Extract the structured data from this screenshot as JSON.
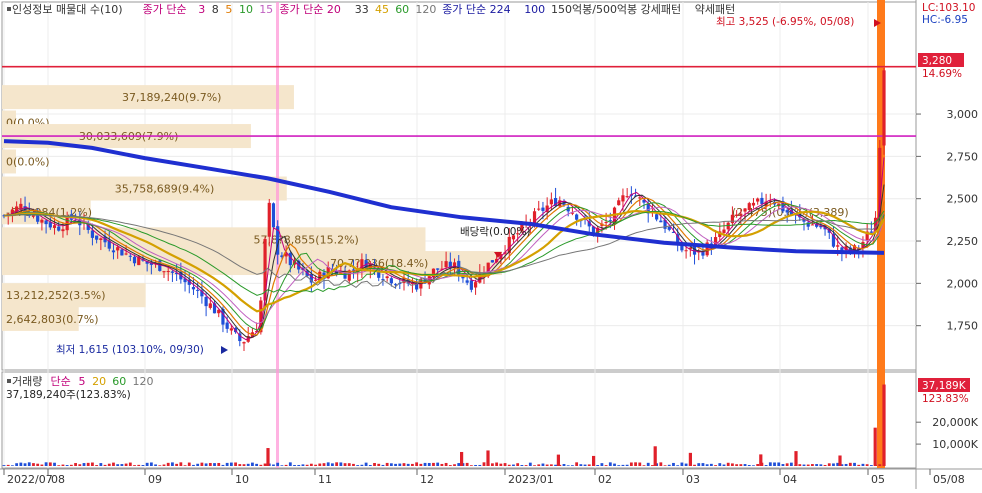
{
  "legend_main": [
    {
      "text": "인성정보 매물대 수(10)",
      "color": "#333333"
    },
    {
      "text": "종가 단순",
      "color": "#c0007a"
    },
    {
      "text": "3",
      "color": "#c0007a"
    },
    {
      "text": "8",
      "color": "#333333"
    },
    {
      "text": "5",
      "color": "#e07a00"
    },
    {
      "text": "10",
      "color": "#2a9a2a"
    },
    {
      "text": "15",
      "color": "#c060c0"
    },
    {
      "text": "종가 단순 20",
      "color": "#c0007a"
    },
    {
      "text": "33",
      "color": "#333333"
    },
    {
      "text": "45",
      "color": "#d4a000"
    },
    {
      "text": "60",
      "color": "#2a9a2a"
    },
    {
      "text": "120",
      "color": "#777777"
    },
    {
      "text": "종가 단순 224",
      "color": "#1a1aa0"
    },
    {
      "text": "100",
      "color": "#1a1aa0"
    },
    {
      "text": "150억봉/500억봉 강세패턴",
      "color": "#333333"
    },
    {
      "text": "약세패턴",
      "color": "#333333"
    }
  ],
  "legend_volume": [
    {
      "text": "거래량",
      "color": "#333333"
    },
    {
      "text": "단순",
      "color": "#c0007a"
    },
    {
      "text": "5",
      "color": "#c0007a"
    },
    {
      "text": "20",
      "color": "#d4a000"
    },
    {
      "text": "60",
      "color": "#2a9a2a"
    },
    {
      "text": "120",
      "color": "#777777"
    }
  ],
  "lc_label": "LC:103.10",
  "hc_label": "HC:-6.95",
  "current_price": "3,280",
  "current_pct": "14.69%",
  "high_label": "최고 3,525 (-6.95%, 05/08)",
  "low_label": "최저 1,615 (103.10%, 09/30)",
  "dividend_label": "배당락(0.00%)",
  "volume_value": "37,189,240주(123.83%)",
  "volume_current": "37,189K",
  "volume_current_pct": "123.83%",
  "colors": {
    "up": "#e0202a",
    "down": "#1f4fd8",
    "ma224": "#1f2fd0",
    "hline_red": "#e0203a",
    "hline_magenta": "#d020c0",
    "profile": "#f5e6cc",
    "highlight_bar": "#ff7a1a"
  },
  "chart_data": {
    "type": "candlestick",
    "price_axis": {
      "ticks": [
        "3,000",
        "2,750",
        "2,500",
        "2,250",
        "2,000",
        "1,750"
      ],
      "values": [
        3000,
        2750,
        2500,
        2250,
        2000,
        1750
      ],
      "range": [
        1500,
        3650
      ]
    },
    "volume_axis": {
      "ticks": [
        "20,000K",
        "10,000K"
      ],
      "values": [
        20000,
        10000
      ],
      "range": [
        0,
        42000
      ]
    },
    "x_axis": {
      "labels": [
        "2022/07",
        "08",
        "09",
        "10",
        "11",
        "12",
        "2023/01",
        "02",
        "03",
        "04",
        "05",
        "05/08"
      ]
    },
    "horizontal_lines": [
      3280,
      2870
    ],
    "volume_profile": [
      {
        "text": "37,189,240(9.7%)",
        "price": 3100,
        "share": 9.7
      },
      {
        "text": "0(0.0%)",
        "price": 2950,
        "share": 0.0
      },
      {
        "text": "30,033,609(7.9%)",
        "price": 2870,
        "share": 7.9
      },
      {
        "text": "0(0.0%)",
        "price": 2720,
        "share": 0.0
      },
      {
        "text": "35,758,689(9.4%)",
        "price": 2560,
        "share": 9.4
      },
      {
        "text": "-678,984(1.2%)",
        "price": 2420,
        "share": 1.2
      },
      {
        "text": "57,8?8,855(15.2%)",
        "price": 2260,
        "share": 15.2
      },
      {
        "text": "70,7?,836(18.4%)",
        "price": 2120,
        "share": 18.4
      },
      {
        "text": "13,212,252(3.5%)",
        "price": 1930,
        "share": 3.5
      },
      {
        "text": "2,642,803(0.7%)",
        "price": 1790,
        "share": 0.7
      }
    ],
    "extra_profile_labels": [
      "(2,475)(0.8%)(3,389)"
    ],
    "ma224_path": [
      [
        0,
        2840
      ],
      [
        0.05,
        2830
      ],
      [
        0.1,
        2800
      ],
      [
        0.16,
        2740
      ],
      [
        0.23,
        2680
      ],
      [
        0.3,
        2620
      ],
      [
        0.37,
        2540
      ],
      [
        0.44,
        2450
      ],
      [
        0.52,
        2390
      ],
      [
        0.6,
        2350
      ],
      [
        0.67,
        2290
      ],
      [
        0.75,
        2240
      ],
      [
        0.83,
        2210
      ],
      [
        0.9,
        2190
      ],
      [
        1.0,
        2180
      ]
    ],
    "price_path": [
      [
        0,
        2400
      ],
      [
        0.02,
        2460
      ],
      [
        0.04,
        2380
      ],
      [
        0.06,
        2330
      ],
      [
        0.08,
        2390
      ],
      [
        0.1,
        2290
      ],
      [
        0.12,
        2230
      ],
      [
        0.14,
        2170
      ],
      [
        0.16,
        2120
      ],
      [
        0.18,
        2100
      ],
      [
        0.2,
        2030
      ],
      [
        0.22,
        1950
      ],
      [
        0.24,
        1840
      ],
      [
        0.26,
        1700
      ],
      [
        0.27,
        1650
      ],
      [
        0.29,
        1760
      ],
      [
        0.3,
        2490
      ],
      [
        0.31,
        2200
      ],
      [
        0.33,
        2100
      ],
      [
        0.35,
        2010
      ],
      [
        0.37,
        2080
      ],
      [
        0.39,
        2060
      ],
      [
        0.41,
        2130
      ],
      [
        0.43,
        2050
      ],
      [
        0.45,
        2010
      ],
      [
        0.47,
        1990
      ],
      [
        0.49,
        2080
      ],
      [
        0.51,
        2110
      ],
      [
        0.53,
        1990
      ],
      [
        0.55,
        2110
      ],
      [
        0.57,
        2220
      ],
      [
        0.59,
        2330
      ],
      [
        0.61,
        2430
      ],
      [
        0.63,
        2500
      ],
      [
        0.65,
        2410
      ],
      [
        0.67,
        2300
      ],
      [
        0.69,
        2380
      ],
      [
        0.71,
        2560
      ],
      [
        0.73,
        2450
      ],
      [
        0.75,
        2350
      ],
      [
        0.77,
        2200
      ],
      [
        0.79,
        2180
      ],
      [
        0.81,
        2260
      ],
      [
        0.83,
        2390
      ],
      [
        0.85,
        2450
      ],
      [
        0.87,
        2510
      ],
      [
        0.89,
        2420
      ],
      [
        0.91,
        2360
      ],
      [
        0.93,
        2330
      ],
      [
        0.95,
        2190
      ],
      [
        0.97,
        2200
      ],
      [
        0.99,
        2350
      ],
      [
        1.0,
        3280
      ]
    ],
    "volume_spikes": [
      {
        "x": 0.3,
        "value": 8200
      },
      {
        "x": 0.52,
        "value": 6400
      },
      {
        "x": 0.55,
        "value": 7100
      },
      {
        "x": 0.63,
        "value": 5200
      },
      {
        "x": 0.67,
        "value": 4600
      },
      {
        "x": 0.74,
        "value": 9000
      },
      {
        "x": 0.78,
        "value": 6000
      },
      {
        "x": 0.86,
        "value": 5300
      },
      {
        "x": 0.9,
        "value": 6800
      },
      {
        "x": 0.95,
        "value": 4800
      },
      {
        "x": 0.99,
        "value": 17500
      },
      {
        "x": 1.0,
        "value": 37189
      }
    ]
  }
}
